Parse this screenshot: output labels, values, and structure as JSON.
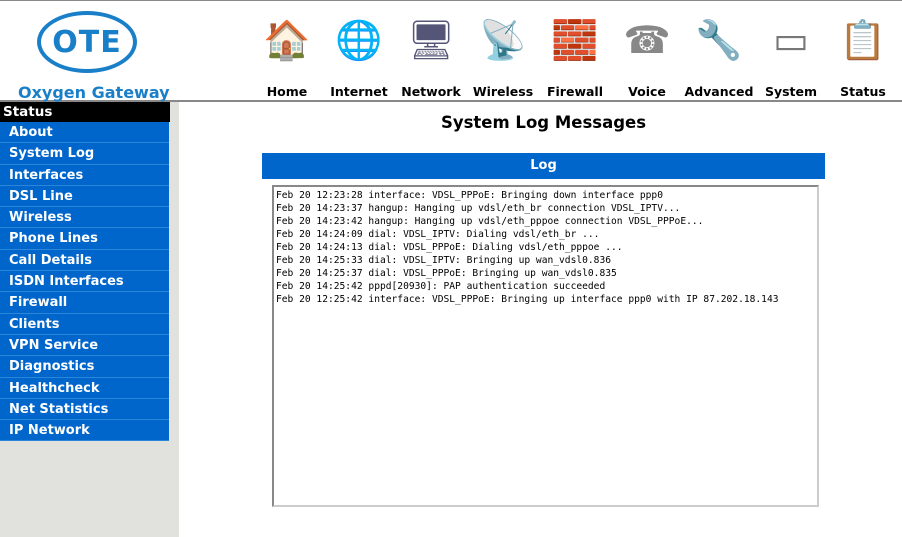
{
  "header": {
    "logo_text": "OTE",
    "brand": "Oxygen Gateway"
  },
  "nav": [
    {
      "label": "Home",
      "icon": "house-icon"
    },
    {
      "label": "Internet",
      "icon": "globe-icon"
    },
    {
      "label": "Network",
      "icon": "network-computers-icon"
    },
    {
      "label": "Wireless",
      "icon": "antenna-icon"
    },
    {
      "label": "Firewall",
      "icon": "firewall-icon"
    },
    {
      "label": "Voice",
      "icon": "phone-icon"
    },
    {
      "label": "Advanced",
      "icon": "tools-icon"
    },
    {
      "label": "System",
      "icon": "router-icon"
    },
    {
      "label": "Status",
      "icon": "clipboard-icon"
    }
  ],
  "sidebar": {
    "header": "Status",
    "items": [
      "About",
      "System Log",
      "Interfaces",
      "DSL Line",
      "Wireless",
      "Phone Lines",
      "Call Details",
      "ISDN Interfaces",
      "Firewall",
      "Clients",
      "VPN Service",
      "Diagnostics",
      "Healthcheck",
      "Net Statistics",
      "IP Network"
    ]
  },
  "main": {
    "title": "System Log Messages",
    "log_header": "Log",
    "log": "Feb 20 12:23:28 interface: VDSL_PPPoE: Bringing down interface ppp0\nFeb 20 14:23:37 hangup: Hanging up vdsl/eth_br connection VDSL_IPTV...\nFeb 20 14:23:42 hangup: Hanging up vdsl/eth_pppoe connection VDSL_PPPoE...\nFeb 20 14:24:09 dial: VDSL_IPTV: Dialing vdsl/eth_br ...\nFeb 20 14:24:13 dial: VDSL_PPPoE: Dialing vdsl/eth_pppoe ...\nFeb 20 14:25:33 dial: VDSL_IPTV: Bringing up wan_vdsl0.836\nFeb 20 14:25:37 dial: VDSL_PPPoE: Bringing up wan_vdsl0.835\nFeb 20 14:25:42 pppd[20930]: PAP authentication succeeded\nFeb 20 12:25:42 interface: VDSL_PPPoE: Bringing up interface ppp0 with IP 87.202.18.143"
  }
}
